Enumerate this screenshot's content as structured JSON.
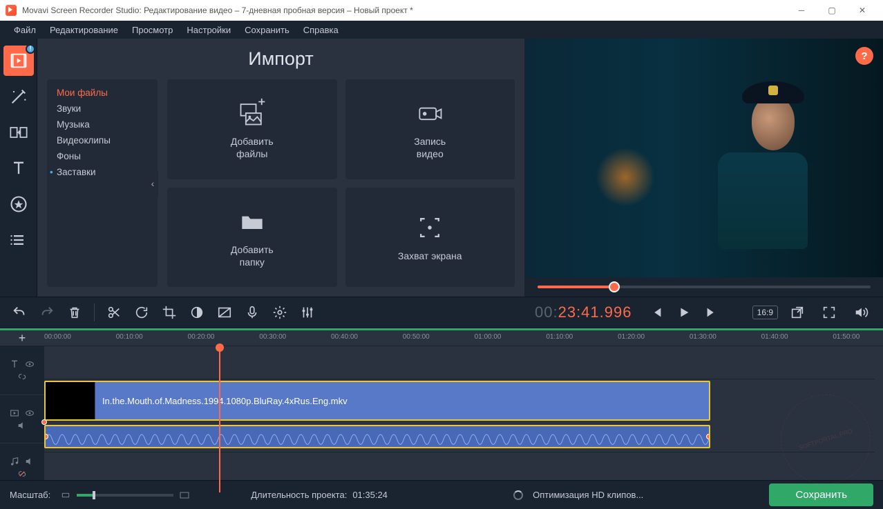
{
  "window": {
    "title": "Movavi Screen Recorder Studio: Редактирование видео – 7-дневная пробная версия – Новый проект *"
  },
  "menu": {
    "file": "Файл",
    "edit": "Редактирование",
    "view": "Просмотр",
    "settings": "Настройки",
    "save": "Сохранить",
    "help": "Справка"
  },
  "import": {
    "title": "Импорт",
    "categories": {
      "my_files": "Мои файлы",
      "sounds": "Звуки",
      "music": "Музыка",
      "video_clips": "Видеоклипы",
      "backgrounds": "Фоны",
      "intros": "Заставки"
    },
    "tiles": {
      "add_files": "Добавить\nфайлы",
      "record_video": "Запись\nвидео",
      "add_folder": "Добавить\nпапку",
      "capture_screen": "Захват экрана"
    }
  },
  "preview": {
    "help": "?",
    "seek_pct": 23,
    "timecode_prefix": "00:",
    "timecode_main": "23:41.996",
    "aspect": "16:9"
  },
  "timeline": {
    "add": "+",
    "ticks": [
      "00:00:00",
      "00:10:00",
      "00:20:00",
      "00:30:00",
      "00:40:00",
      "00:50:00",
      "01:00:00",
      "01:10:00",
      "01:20:00",
      "01:30:00",
      "01:40:00",
      "01:50:00"
    ],
    "playhead_pct": 20.8,
    "clip": {
      "start_pct": 0,
      "end_pct": 80.2,
      "label": "In.the.Mouth.of.Madness.1994.1080p.BluRay.4xRus.Eng.mkv"
    }
  },
  "status": {
    "zoom_label": "Масштаб:",
    "zoom_pct": 16,
    "duration_label": "Длительность проекта:",
    "duration_value": "01:35:24",
    "optimizing": "Оптимизация HD клипов...",
    "save_button": "Сохранить"
  },
  "colors": {
    "accent": "#ff6b4a",
    "success": "#2fa868",
    "timeline_clip": "#5878c8",
    "clip_border": "#e8c838"
  }
}
